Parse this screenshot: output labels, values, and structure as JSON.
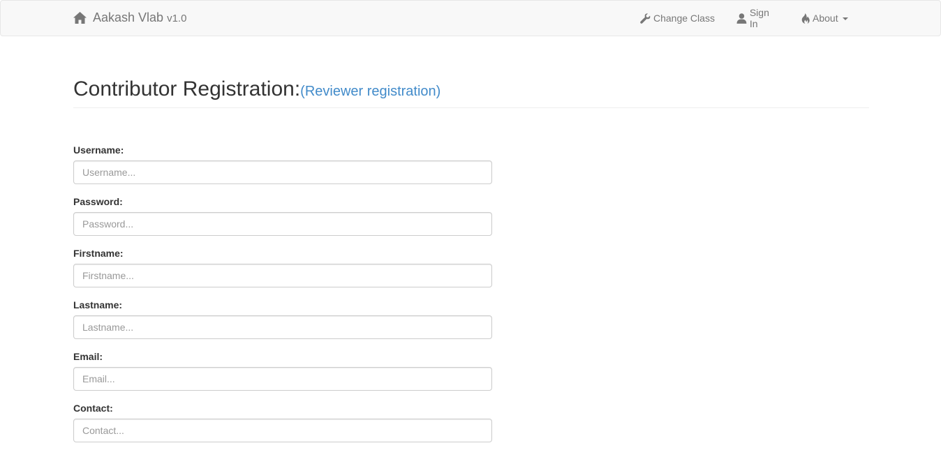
{
  "navbar": {
    "brand_name": "Aakash Vlab",
    "brand_version": "v1.0",
    "brand_icon": "home-icon",
    "change_class_label": "Change Class",
    "change_class_icon": "wrench-icon",
    "sign_in_label": "Sign In",
    "sign_in_icon": "user-icon",
    "about_label": "About",
    "about_icon": "fire-icon"
  },
  "header": {
    "title": "Contributor Registration:",
    "alt_link": "(Reviewer registration)"
  },
  "form": {
    "fields": [
      {
        "label": "Username:",
        "placeholder": "Username..."
      },
      {
        "label": "Password:",
        "placeholder": "Password..."
      },
      {
        "label": "Firstname:",
        "placeholder": "Firstname..."
      },
      {
        "label": "Lastname:",
        "placeholder": "Lastname..."
      },
      {
        "label": "Email:",
        "placeholder": "Email..."
      },
      {
        "label": "Contact:",
        "placeholder": "Contact..."
      }
    ]
  },
  "colors": {
    "link": "#428bca",
    "nav_text": "#777777",
    "navbar_bg": "#f8f8f8"
  }
}
